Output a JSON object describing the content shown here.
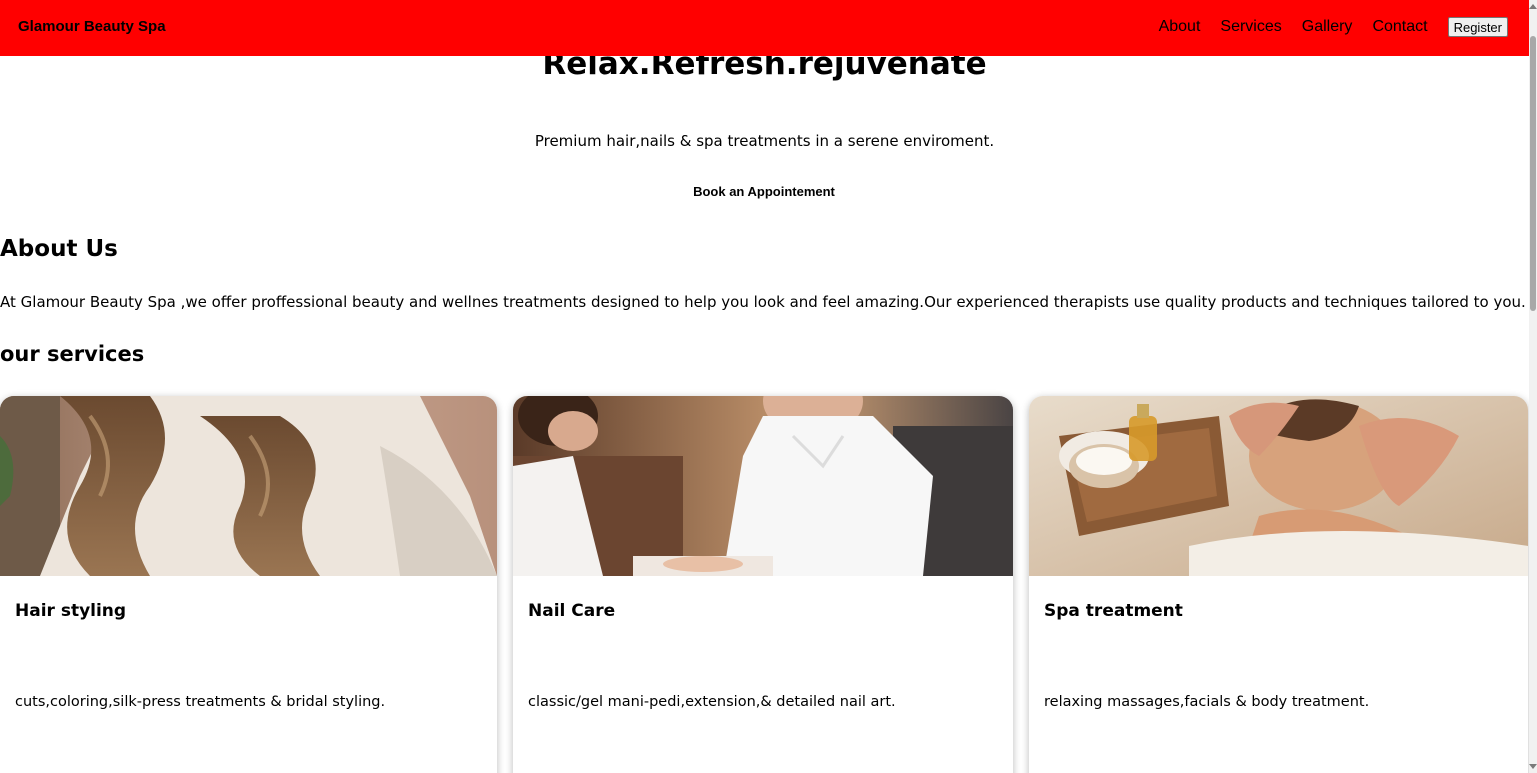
{
  "navbar": {
    "brand": "Glamour Beauty Spa",
    "links": [
      "About",
      "Services",
      "Gallery",
      "Contact"
    ],
    "register_label": "Register",
    "color": "#ff0000"
  },
  "hero": {
    "title": "Relax.Refresh.rejuvenate",
    "subtitle": "Premium hair,nails & spa treatments in a serene enviroment.",
    "cta_label": "Book an Appointement"
  },
  "about": {
    "title": "About Us",
    "text": "At Glamour Beauty Spa ,we offer proffessional beauty and wellnes treatments designed to help you look and feel amazing.Our experienced therapists use quality products and techniques tailored to you."
  },
  "services": {
    "title": "our services",
    "items": [
      {
        "title": "Hair styling",
        "description": "cuts,coloring,silk-press treatments & bridal styling."
      },
      {
        "title": "Nail Care",
        "description": "classic/gel mani-pedi,extension,& detailed nail art."
      },
      {
        "title": "Spa treatment",
        "description": "relaxing massages,facials & body treatment."
      }
    ]
  }
}
